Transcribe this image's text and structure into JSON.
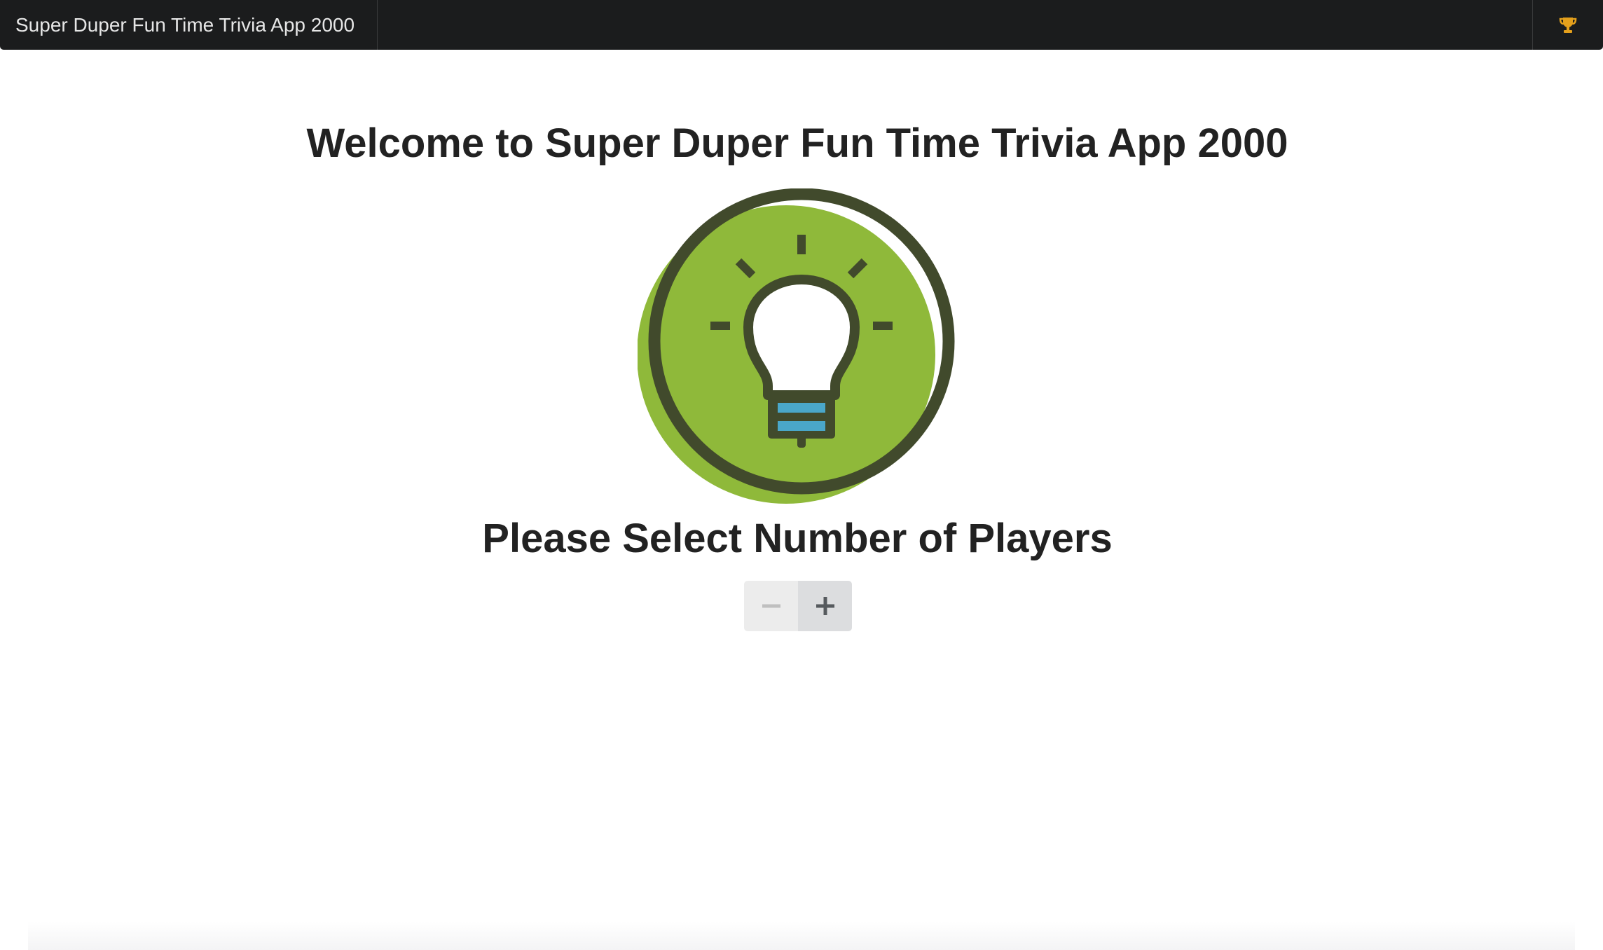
{
  "navbar": {
    "brand": "Super Duper Fun Time Trivia App 2000",
    "right_icon": "trophy-icon",
    "right_icon_color": "#e4a01c"
  },
  "main": {
    "welcome_title": "Welcome to Super Duper Fun Time Trivia App 2000",
    "logo_icon": "lightbulb-icon",
    "players_title": "Please Select Number of Players",
    "stepper": {
      "decrement_icon": "minus-icon",
      "increment_icon": "plus-icon"
    }
  },
  "colors": {
    "navbar_bg": "#1b1c1d",
    "logo_green": "#8fb93a",
    "logo_outline": "#414a2c",
    "bulb_accent": "#4aa7c9"
  }
}
